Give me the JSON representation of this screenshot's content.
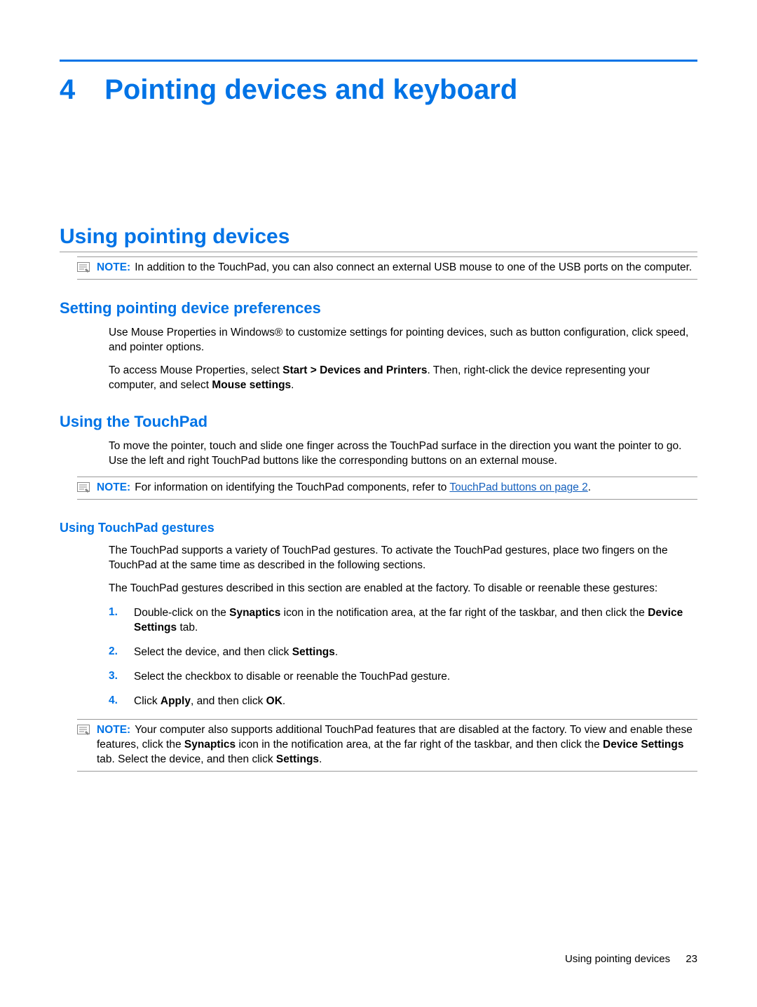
{
  "chapter": {
    "number": "4",
    "title": "Pointing devices and keyboard"
  },
  "section1": {
    "title": "Using pointing devices",
    "note1": {
      "label": "NOTE:",
      "text": "In addition to the TouchPad, you can also connect an external USB mouse to one of the USB ports on the computer."
    },
    "sub1": {
      "title": "Setting pointing device preferences",
      "p1": "Use Mouse Properties in Windows® to customize settings for pointing devices, such as button configuration, click speed, and pointer options.",
      "p2_pre": "To access Mouse Properties, select ",
      "p2_bold1": "Start > Devices and Printers",
      "p2_mid": ". Then, right-click the device representing your computer, and select ",
      "p2_bold2": "Mouse settings",
      "p2_post": "."
    },
    "sub2": {
      "title": "Using the TouchPad",
      "p1": "To move the pointer, touch and slide one finger across the TouchPad surface in the direction you want the pointer to go. Use the left and right TouchPad buttons like the corresponding buttons on an external mouse.",
      "note": {
        "label": "NOTE:",
        "pre": "For information on identifying the TouchPad components, refer to ",
        "link": "TouchPad buttons on page 2",
        "post": "."
      },
      "sub": {
        "title": "Using TouchPad gestures",
        "p1": "The TouchPad supports a variety of TouchPad gestures. To activate the TouchPad gestures, place two fingers on the TouchPad at the same time as described in the following sections.",
        "p2": "The TouchPad gestures described in this section are enabled at the factory. To disable or reenable these gestures:",
        "list": [
          {
            "n": "1.",
            "pre": "Double-click on the ",
            "b1": "Synaptics",
            "mid": " icon in the notification area, at the far right of the taskbar, and then click the ",
            "b2": "Device Settings",
            "post": " tab."
          },
          {
            "n": "2.",
            "pre": "Select the device, and then click ",
            "b1": "Settings",
            "mid": "",
            "b2": "",
            "post": "."
          },
          {
            "n": "3.",
            "pre": "Select the checkbox to disable or reenable the TouchPad gesture.",
            "b1": "",
            "mid": "",
            "b2": "",
            "post": ""
          },
          {
            "n": "4.",
            "pre": "Click ",
            "b1": "Apply",
            "mid": ", and then click ",
            "b2": "OK",
            "post": "."
          }
        ],
        "note": {
          "label": "NOTE:",
          "pre": "Your computer also supports additional TouchPad features that are disabled at the factory. To view and enable these features, click the ",
          "b1": "Synaptics",
          "mid": " icon in the notification area, at the far right of the taskbar, and then click the ",
          "b2": "Device Settings",
          "mid2": " tab. Select the device, and then click ",
          "b3": "Settings",
          "post": "."
        }
      }
    }
  },
  "footer": {
    "section": "Using pointing devices",
    "page": "23"
  }
}
